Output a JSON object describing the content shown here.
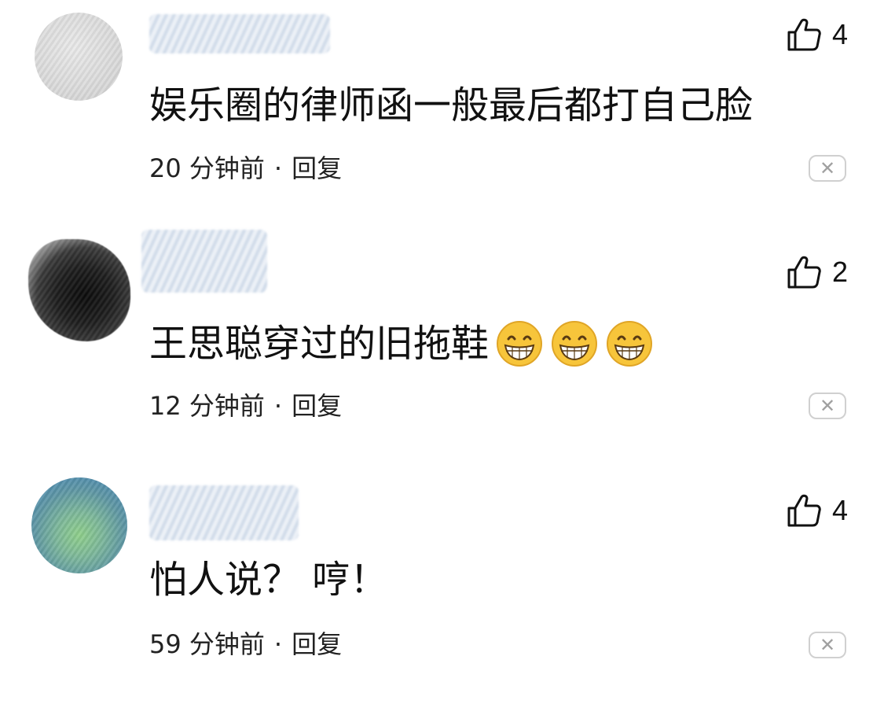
{
  "comments": [
    {
      "text": "娱乐圈的律师函一般最后都打自己脸",
      "emojis": [],
      "time": "20 分钟前",
      "reply_label": "回复",
      "likes": "4"
    },
    {
      "text": "王思聪穿过的旧拖鞋",
      "emojis": [
        "grin-emoji",
        "grin-emoji",
        "grin-emoji"
      ],
      "time": "12 分钟前",
      "reply_label": "回复",
      "likes": "2"
    },
    {
      "text": "怕人说？ 哼！",
      "emojis": [],
      "time": "59 分钟前",
      "reply_label": "回复",
      "likes": "4"
    }
  ],
  "separator": "·",
  "close_glyph": "✕",
  "icons": {
    "like": "thumbs-up-icon",
    "close": "close-icon",
    "emoji": "grinning-face-icon"
  },
  "colors": {
    "text": "#111111",
    "meta": "#222222",
    "close_border": "#d0d0d0",
    "emoji_face": "#f7c53b"
  }
}
